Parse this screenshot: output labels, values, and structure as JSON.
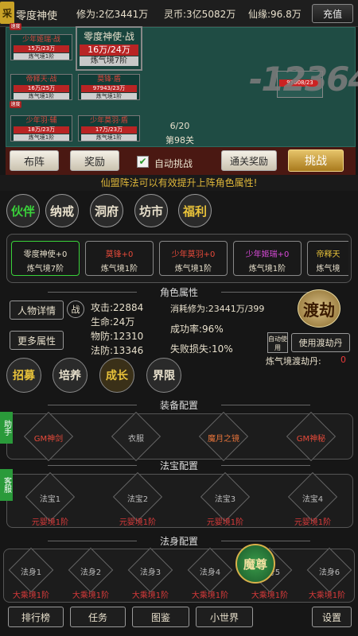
{
  "header": {
    "logo_char": "采",
    "title": "零度神使",
    "cultivation": "修为:2亿3441万",
    "spirit_coin": "灵币:3亿5082万",
    "fate": "仙缘:96.8万",
    "recharge_label": "充值"
  },
  "battle": {
    "allies": [
      {
        "name": "少年姬瑞·战",
        "hp": "15万/23万",
        "level": "炼气境1阶"
      },
      {
        "name": "帝释天·战",
        "hp": "16万/25万",
        "level": "炼气境1阶"
      },
      {
        "name": "莫锋·盾",
        "hp": "97943/23万",
        "level": "炼气境1阶"
      },
      {
        "name": "少年羽·辅",
        "hp": "18万/23万",
        "level": "炼气境1阶"
      },
      {
        "name": "少年莫羽·盾",
        "hp": "17万/23万",
        "level": "炼气境1阶"
      }
    ],
    "tag_label": "速度",
    "leader": {
      "name": "零度神使·战",
      "hp": "16万/24万",
      "level": "炼气境7阶"
    },
    "damage": "-12364",
    "enemy_hp": "97008/23",
    "wave": "6/20",
    "stage": "第98关",
    "formation_label": "布阵",
    "reward_label": "奖励",
    "auto_checked": "✔",
    "auto_label": "自动挑战",
    "clear_reward_label": "通关奖励",
    "challenge_label": "挑战"
  },
  "tip": "仙盟阵法可以有效提升上阵角色属性!",
  "categories": [
    {
      "label": "伙伴",
      "color": "#3ad23a"
    },
    {
      "label": "纳戒",
      "color": "#e8e0cc"
    },
    {
      "label": "洞府",
      "color": "#e8e0cc"
    },
    {
      "label": "坊市",
      "color": "#e8e0cc"
    },
    {
      "label": "福利",
      "color": "#e8c23a"
    }
  ],
  "partners": [
    {
      "name": "零度神使+0",
      "level": "炼气境7阶",
      "color": "#e8e0cc"
    },
    {
      "name": "莫锋+0",
      "level": "炼气境1阶",
      "color": "#e84a3a"
    },
    {
      "name": "少年莫羽+0",
      "level": "炼气境1阶",
      "color": "#e84a3a"
    },
    {
      "name": "少年姬瑞+0",
      "level": "炼气境1阶",
      "color": "#d84ad8"
    },
    {
      "name": "帝释天",
      "level": "炼气境",
      "color": "#e8c23a"
    }
  ],
  "attributes": {
    "section_title": "角色属性",
    "detail_label": "人物详情",
    "battle_badge": "战",
    "more_label": "更多属性",
    "attack": "攻击:22884",
    "hp": "生命:24万",
    "phys_def": "物防:12310",
    "mag_def": "法防:13346",
    "cost": "消耗修为:23441万/399",
    "success": "成功率:96%",
    "fail_loss": "失败损失:10%",
    "tribulation_label": "渡劫",
    "auto_use_label": "自动使用",
    "use_pill_label": "使用渡劫丹",
    "pill_label": "炼气境渡劫丹:",
    "pill_count": "0",
    "actions": [
      {
        "label": "招募",
        "color": "#e8c23a"
      },
      {
        "label": "培养",
        "color": "#e8e0cc"
      },
      {
        "label": "成长",
        "color": "#e8c23a"
      },
      {
        "label": "界限",
        "color": "#e8e0cc"
      }
    ]
  },
  "equipment": {
    "section_title": "装备配置",
    "side_label": "助手",
    "slots": [
      {
        "label": "GM神剑",
        "color": "#e84a3a"
      },
      {
        "label": "衣服",
        "color": "#aaaaaa"
      },
      {
        "label": "魔月之镜",
        "color": "#e8743a"
      },
      {
        "label": "GM神秘",
        "color": "#e84a3a"
      }
    ]
  },
  "treasure": {
    "section_title": "法宝配置",
    "side_label": "客服",
    "slots": [
      {
        "label": "法宝1",
        "sub": "元婴境1阶"
      },
      {
        "label": "法宝2",
        "sub": "元婴境1阶"
      },
      {
        "label": "法宝3",
        "sub": "元婴境1阶"
      },
      {
        "label": "法宝4",
        "sub": "元婴境1阶"
      }
    ]
  },
  "body_config": {
    "section_title": "法身配置",
    "badge": "魔尊",
    "slots": [
      {
        "label": "法身1",
        "sub": "大乘境1阶"
      },
      {
        "label": "法身2",
        "sub": "大乘境1阶"
      },
      {
        "label": "法身3",
        "sub": "大乘境1阶"
      },
      {
        "label": "法身4",
        "sub": "大乘境1阶"
      },
      {
        "label": "法身5",
        "sub": "大乘境1阶"
      },
      {
        "label": "法身6",
        "sub": "大乘境1阶"
      }
    ]
  },
  "bottom_nav": {
    "ranking": "排行榜",
    "tasks": "任务",
    "collection": "图鉴",
    "small_world": "小世界",
    "settings": "设置"
  }
}
